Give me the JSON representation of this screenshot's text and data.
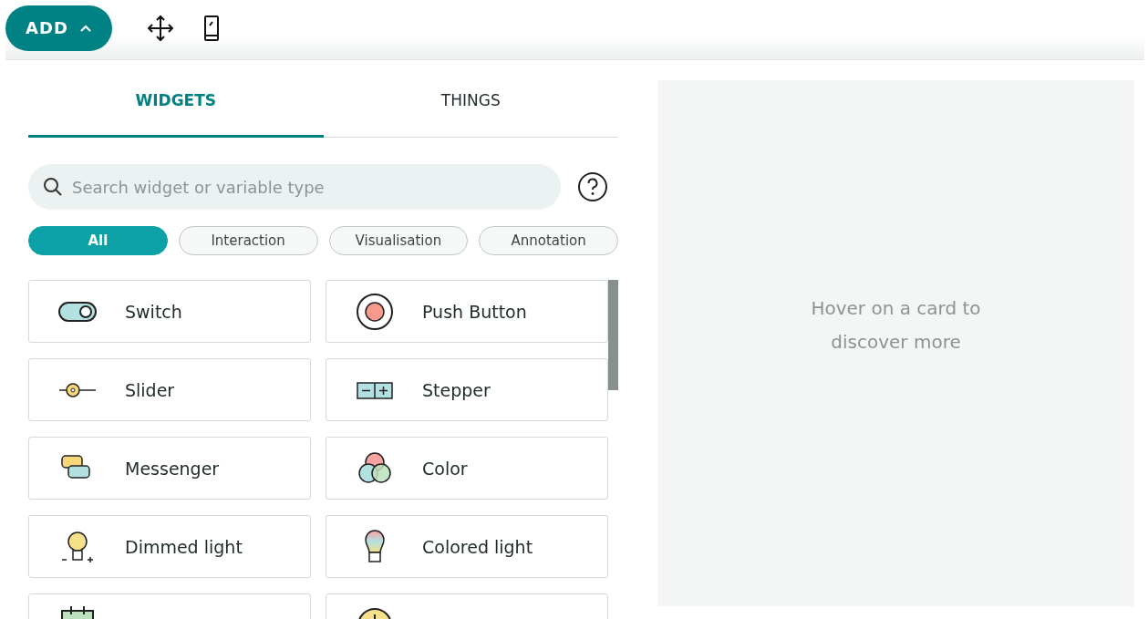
{
  "toolbar": {
    "add_button": "ADD"
  },
  "tabs": [
    {
      "label": "WIDGETS",
      "selected": true
    },
    {
      "label": "THINGS",
      "selected": false
    }
  ],
  "search": {
    "placeholder": "Search widget or variable type"
  },
  "filters": [
    {
      "label": "All",
      "selected": true
    },
    {
      "label": "Interaction",
      "selected": false
    },
    {
      "label": "Visualisation",
      "selected": false
    },
    {
      "label": "Annotation",
      "selected": false
    }
  ],
  "widgets": [
    {
      "kind": "switch",
      "label": "Switch"
    },
    {
      "kind": "pushbutton",
      "label": "Push Button"
    },
    {
      "kind": "slider",
      "label": "Slider"
    },
    {
      "kind": "stepper",
      "label": "Stepper"
    },
    {
      "kind": "messenger",
      "label": "Messenger"
    },
    {
      "kind": "color",
      "label": "Color"
    },
    {
      "kind": "dimmed",
      "label": "Dimmed light"
    },
    {
      "kind": "coloredlight",
      "label": "Colored light"
    },
    {
      "kind": "calendar"
    },
    {
      "kind": "clock"
    }
  ],
  "info_panel": {
    "text": "Hover on a card to discover more"
  }
}
